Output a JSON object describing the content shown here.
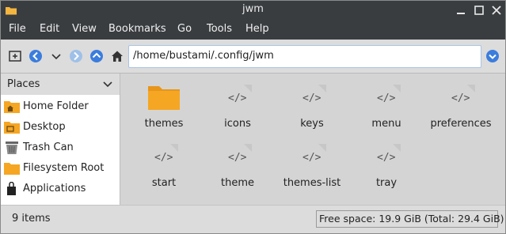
{
  "window": {
    "title": "jwm"
  },
  "menubar": {
    "items": [
      "File",
      "Edit",
      "View",
      "Bookmarks",
      "Go",
      "Tools",
      "Help"
    ]
  },
  "toolbar": {
    "path": "/home/bustami/.config/jwm"
  },
  "sidebar": {
    "header": "Places",
    "items": [
      {
        "label": "Home Folder",
        "icon": "home-folder-icon"
      },
      {
        "label": "Desktop",
        "icon": "desktop-folder-icon"
      },
      {
        "label": "Trash Can",
        "icon": "trash-icon"
      },
      {
        "label": "Filesystem Root",
        "icon": "folder-icon"
      },
      {
        "label": "Applications",
        "icon": "applications-icon"
      }
    ]
  },
  "files": [
    {
      "name": "themes",
      "type": "folder"
    },
    {
      "name": "icons",
      "type": "code"
    },
    {
      "name": "keys",
      "type": "code"
    },
    {
      "name": "menu",
      "type": "code"
    },
    {
      "name": "preferences",
      "type": "code"
    },
    {
      "name": "start",
      "type": "code"
    },
    {
      "name": "theme",
      "type": "code"
    },
    {
      "name": "themes-list",
      "type": "code"
    },
    {
      "name": "tray",
      "type": "code"
    }
  ],
  "status": {
    "count": "9 items",
    "free_space": "Free space: 19.9 GiB (Total: 29.4 GiB)"
  },
  "colors": {
    "titlebar": "#3a3d40",
    "folder": "#f5a623",
    "accent_blue": "#3b7ddd"
  }
}
